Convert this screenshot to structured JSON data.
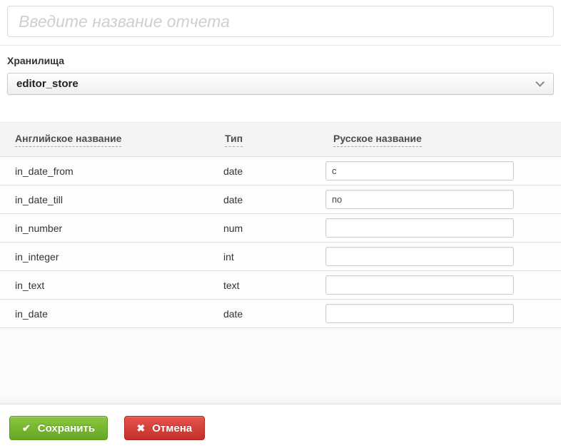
{
  "report_name": {
    "placeholder": "Введите название отчета",
    "value": ""
  },
  "storage": {
    "label": "Хранилища",
    "selected_option": "editor_store"
  },
  "params_table": {
    "headers": {
      "english_name": "Английское название",
      "type": "Тип",
      "russian_name": "Русское название"
    },
    "rows": [
      {
        "en": "in_date_from",
        "type": "date",
        "ru": "с"
      },
      {
        "en": "in_date_till",
        "type": "date",
        "ru": "по"
      },
      {
        "en": "in_number",
        "type": "num",
        "ru": ""
      },
      {
        "en": "in_integer",
        "type": "int",
        "ru": ""
      },
      {
        "en": "in_text",
        "type": "text",
        "ru": ""
      },
      {
        "en": "in_date",
        "type": "date",
        "ru": ""
      }
    ]
  },
  "actions": {
    "save_label": "Сохранить",
    "cancel_label": "Отмена"
  },
  "icons": {
    "check": "✔",
    "cross": "✖"
  },
  "colors": {
    "save_green": "#6fb02f",
    "cancel_red": "#d43f38",
    "header_bg": "#f4f4f4",
    "row_border": "#dce4ea"
  }
}
